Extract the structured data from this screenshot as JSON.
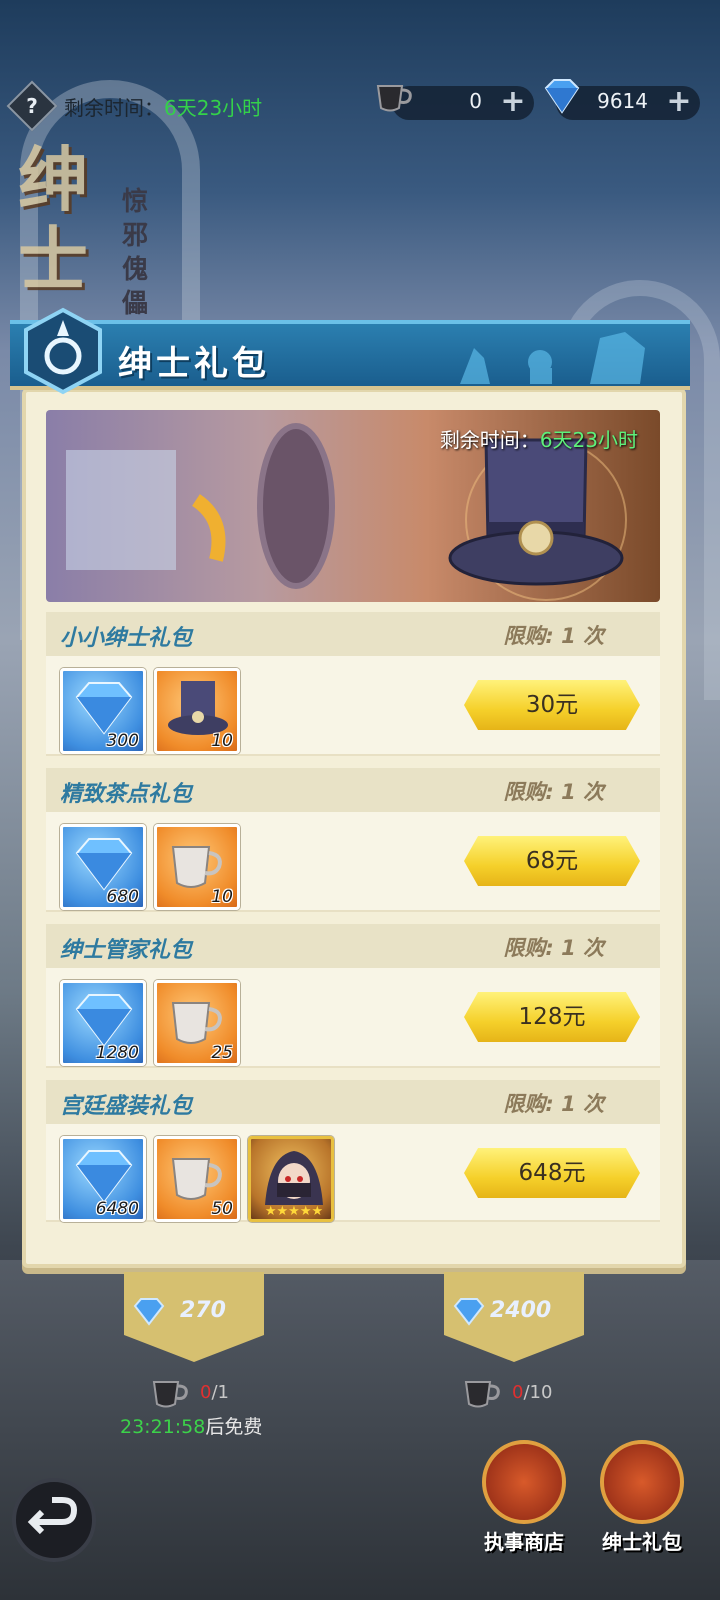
{
  "background": {
    "title_big": "绅士",
    "title_small": "惊邪傀儡"
  },
  "topbar": {
    "help_label": "?",
    "timer_label": "剩余时间：",
    "timer_value": "6天23小时",
    "cup_count": "0",
    "gem_count": "9614",
    "plus_label": "+"
  },
  "panel": {
    "title": "绅士礼包",
    "banner_timer_label": "剩余时间：",
    "banner_timer_value": "6天23小时"
  },
  "packs": [
    {
      "name": "小小绅士礼包",
      "limit": "限购: 1 次",
      "items": [
        "300",
        "10"
      ],
      "price": "30元"
    },
    {
      "name": "精致茶点礼包",
      "limit": "限购: 1 次",
      "items": [
        "680",
        "10"
      ],
      "price": "68元"
    },
    {
      "name": "绅士管家礼包",
      "limit": "限购: 1 次",
      "items": [
        "1280",
        "25"
      ],
      "price": "128元"
    },
    {
      "name": "宫廷盛装礼包",
      "limit": "限购: 1 次",
      "items": [
        "6480",
        "50"
      ],
      "price": "648元"
    }
  ],
  "recruit": {
    "single_cost": "270",
    "ten_cost": "2400",
    "single_cups_used": "0",
    "single_cups_total": "/1",
    "ten_cups_used": "0",
    "ten_cups_total": "/10",
    "free_time": "23:21:58",
    "free_suffix": "后免费"
  },
  "bottom_nav": {
    "shop_label": "执事商店",
    "gift_label": "绅士礼包"
  },
  "colors": {
    "accent_blue": "#2b7fb0",
    "price_yellow": "#f5d02a",
    "timer_green": "#34d14a",
    "panel_cream": "#f4efd8"
  }
}
